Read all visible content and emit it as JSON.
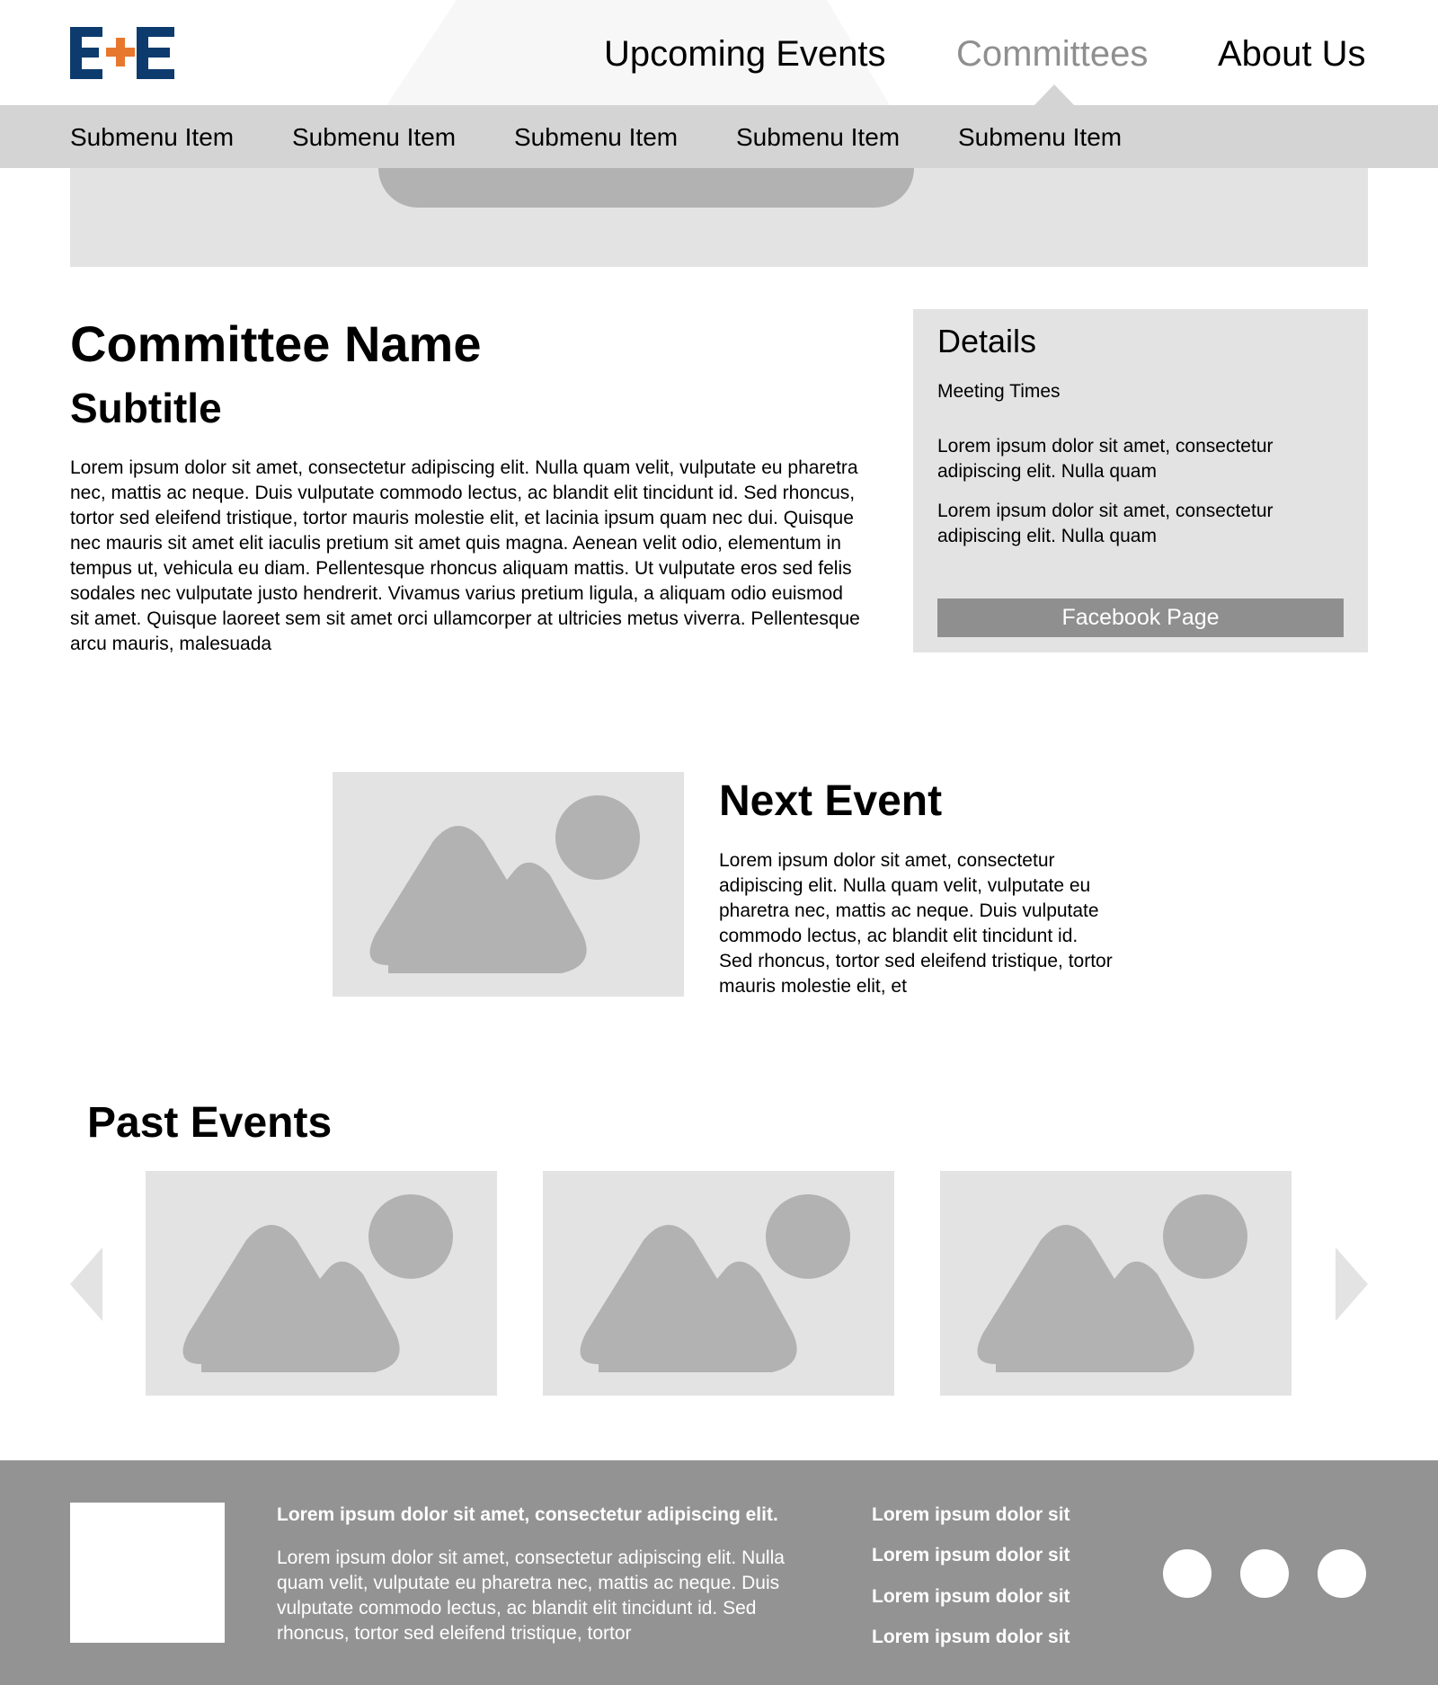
{
  "header": {
    "logo_text": "E+E",
    "nav": [
      {
        "label": "Upcoming Events",
        "active": false
      },
      {
        "label": "Committees",
        "active": true
      },
      {
        "label": "About Us",
        "active": false
      }
    ],
    "submenu": [
      "Submenu Item",
      "Submenu Item",
      "Submenu Item",
      "Submenu Item",
      "Submenu Item"
    ]
  },
  "committee": {
    "title": "Committee Name",
    "subtitle": "Subtitle",
    "body": "Lorem ipsum dolor sit amet, consectetur adipiscing elit. Nulla quam velit, vulputate eu pharetra nec, mattis ac neque. Duis vulputate commodo lectus, ac blandit elit tincidunt id. Sed rhoncus, tortor sed eleifend tristique, tortor mauris molestie elit, et lacinia ipsum quam nec dui. Quisque nec mauris sit amet elit iaculis pretium sit amet quis magna. Aenean velit odio, elementum in tempus ut, vehicula eu diam. Pellentesque rhoncus aliquam mattis. Ut vulputate eros sed felis sodales nec vulputate justo hendrerit. Vivamus varius pretium ligula, a aliquam odio euismod sit amet. Quisque laoreet sem sit amet orci ullamcorper at ultricies metus viverra. Pellentesque arcu mauris, malesuada"
  },
  "details": {
    "title": "Details",
    "meeting_label": "Meeting Times",
    "text_1": "Lorem ipsum dolor sit amet, consectetur adipiscing elit. Nulla quam",
    "text_2": "Lorem ipsum dolor sit amet, consectetur adipiscing elit. Nulla quam",
    "button_label": "Facebook Page"
  },
  "next_event": {
    "title": "Next Event",
    "body": "Lorem ipsum dolor sit amet, consectetur adipiscing elit. Nulla quam velit, vulputate eu pharetra nec, mattis ac neque. Duis vulputate commodo lectus, ac blandit elit tincidunt id. Sed rhoncus, tortor sed eleifend tristique, tortor mauris molestie elit, et"
  },
  "past_events": {
    "title": "Past Events",
    "items": 3
  },
  "footer": {
    "heading": "Lorem ipsum dolor sit amet, consectetur adipiscing elit.",
    "body": "Lorem ipsum dolor sit amet, consectetur adipiscing elit. Nulla quam velit, vulputate eu pharetra nec, mattis ac neque. Duis vulputate commodo lectus, ac blandit elit tincidunt id. Sed rhoncus, tortor sed eleifend tristique, tortor",
    "links": [
      "Lorem ipsum dolor sit",
      "Lorem ipsum dolor sit",
      "Lorem ipsum dolor sit",
      "Lorem ipsum dolor sit"
    ],
    "social_icons": [
      "social-circle-icon",
      "social-circle-icon",
      "social-circle-icon"
    ]
  },
  "colors": {
    "logo_navy": "#0d3b6e",
    "logo_orange": "#e8772e",
    "placeholder_bg": "#e3e3e3",
    "placeholder_shape": "#b2b2b2",
    "submenu_bg": "#d4d4d4",
    "button_bg": "#8f8f8f",
    "footer_bg": "#939393"
  }
}
